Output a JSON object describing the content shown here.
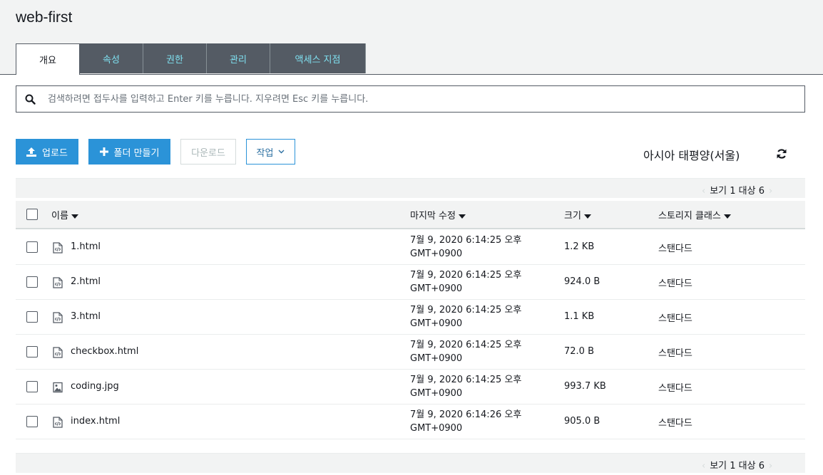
{
  "bucket": {
    "title": "web-first"
  },
  "tabs": [
    {
      "label": "개요"
    },
    {
      "label": "속성"
    },
    {
      "label": "권한"
    },
    {
      "label": "관리"
    },
    {
      "label": "액세스 지점"
    }
  ],
  "search": {
    "placeholder": "검색하려면 접두사를 입력하고 Enter 키를 누릅니다. 지우려면 Esc 키를 누릅니다.",
    "value": ""
  },
  "toolbar": {
    "upload_label": "업로드",
    "create_folder_label": "폴더 만들기",
    "download_label": "다운로드",
    "actions_label": "작업",
    "region": "아시아 태평양(서울)"
  },
  "pagination": {
    "text": "보기 1 대상 6"
  },
  "table": {
    "headers": {
      "name": "이름",
      "last_modified": "마지막 수정",
      "size": "크기",
      "storage_class": "스토리지 클래스"
    },
    "rows": [
      {
        "name": "1.html",
        "type": "html-file-icon",
        "date_line1": "7월 9, 2020 6:14:25 오후",
        "date_line2": "GMT+0900",
        "size": "1.2 KB",
        "storage_class": "스탠다드"
      },
      {
        "name": "2.html",
        "type": "html-file-icon",
        "date_line1": "7월 9, 2020 6:14:25 오후",
        "date_line2": "GMT+0900",
        "size": "924.0 B",
        "storage_class": "스탠다드"
      },
      {
        "name": "3.html",
        "type": "html-file-icon",
        "date_line1": "7월 9, 2020 6:14:25 오후",
        "date_line2": "GMT+0900",
        "size": "1.1 KB",
        "storage_class": "스탠다드"
      },
      {
        "name": "checkbox.html",
        "type": "html-file-icon",
        "date_line1": "7월 9, 2020 6:14:25 오후",
        "date_line2": "GMT+0900",
        "size": "72.0 B",
        "storage_class": "스탠다드"
      },
      {
        "name": "coding.jpg",
        "type": "image-file-icon",
        "date_line1": "7월 9, 2020 6:14:25 오후",
        "date_line2": "GMT+0900",
        "size": "993.7 KB",
        "storage_class": "스탠다드"
      },
      {
        "name": "index.html",
        "type": "html-file-icon",
        "date_line1": "7월 9, 2020 6:14:26 오후",
        "date_line2": "GMT+0900",
        "size": "905.0 B",
        "storage_class": "스탠다드"
      }
    ]
  },
  "colors": {
    "primary": "#2b93d8",
    "tab_bg": "#545b64",
    "tab_text": "#7fe0f0",
    "header_bg": "#f2f3f3"
  }
}
